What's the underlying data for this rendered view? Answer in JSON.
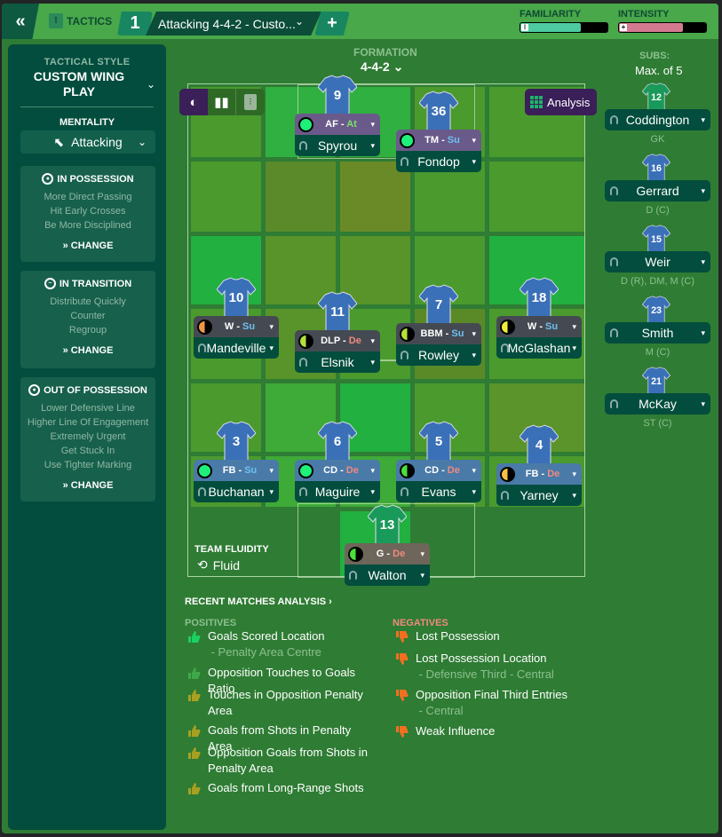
{
  "topbar": {
    "back_icon": "double-chevron-left",
    "tactics_label": "TACTICS",
    "tactic_slot": "1",
    "tactic_name": "Attacking 4-4-2 - Custo...",
    "add_label": "+",
    "familiarity": {
      "label": "FAMILIARITY",
      "value": 0.68,
      "color": "#4ecba0"
    },
    "intensity": {
      "label": "INTENSITY",
      "value": 0.72,
      "color": "#d47a90"
    }
  },
  "left": {
    "tactical_style_label": "TACTICAL STYLE",
    "tactical_style": "CUSTOM WING PLAY",
    "mentality_label": "MENTALITY",
    "mentality": "Attacking",
    "cards": [
      {
        "title": "IN POSSESSION",
        "icon": "football-icon",
        "lines": [
          "More Direct Passing",
          "Hit Early Crosses",
          "Be More Disciplined"
        ],
        "change": "CHANGE"
      },
      {
        "title": "IN TRANSITION",
        "icon": "transition-icon",
        "lines": [
          "Distribute Quickly",
          "Counter",
          "Regroup"
        ],
        "change": "CHANGE"
      },
      {
        "title": "OUT OF POSSESSION",
        "icon": "football-icon",
        "lines": [
          "Lower Defensive Line",
          "Higher Line Of Engagement",
          "Extremely Urgent",
          "Get Stuck In",
          "Use Tighter Marking"
        ],
        "change": "CHANGE"
      }
    ]
  },
  "formation": {
    "label": "FORMATION",
    "value": "4-4-2"
  },
  "analysis_button": "Analysis",
  "players": [
    {
      "number": "9",
      "role": "AF",
      "duty": "At",
      "name": "Spyrou",
      "role_bg": "#6a5a8a",
      "condition": "full",
      "cond_color": "#1ef07a"
    },
    {
      "number": "36",
      "role": "TM",
      "duty": "Su",
      "name": "Fondop",
      "role_bg": "#6a5a8a",
      "condition": "full",
      "cond_color": "#1ef07a"
    },
    {
      "number": "10",
      "role": "W",
      "duty": "Su",
      "name": "Mandeville",
      "role_bg": "#454a52",
      "condition": "half",
      "cond_color": "#f0964a"
    },
    {
      "number": "11",
      "role": "DLP",
      "duty": "De",
      "name": "Elsnik",
      "role_bg": "#454a52",
      "condition": "half",
      "cond_color": "#b4e03a"
    },
    {
      "number": "7",
      "role": "BBM",
      "duty": "Su",
      "name": "Rowley",
      "role_bg": "#454a52",
      "condition": "half",
      "cond_color": "#b4e03a"
    },
    {
      "number": "18",
      "role": "W",
      "duty": "Su",
      "name": "McGlashan",
      "role_bg": "#454a52",
      "condition": "half",
      "cond_color": "#f0ec3a"
    },
    {
      "number": "3",
      "role": "FB",
      "duty": "Su",
      "name": "Buchanan",
      "role_bg": "#4a7aa8",
      "condition": "full",
      "cond_color": "#1ef07a"
    },
    {
      "number": "6",
      "role": "CD",
      "duty": "De",
      "name": "Maguire",
      "role_bg": "#4a7aa8",
      "condition": "full",
      "cond_color": "#1ef07a"
    },
    {
      "number": "5",
      "role": "CD",
      "duty": "De",
      "name": "Evans",
      "role_bg": "#4a7aa8",
      "condition": "half",
      "cond_color": "#4ae03a"
    },
    {
      "number": "4",
      "role": "FB",
      "duty": "De",
      "name": "Yarney",
      "role_bg": "#4a7aa8",
      "condition": "half",
      "cond_color": "#f8c048"
    },
    {
      "number": "13",
      "role": "G",
      "duty": "De",
      "name": "Walton",
      "role_bg": "#6e665a",
      "condition": "half",
      "cond_color": "#4ae03a",
      "gk": true
    }
  ],
  "team_fluidity": {
    "label": "TEAM FLUIDITY",
    "value": "Fluid"
  },
  "subs": {
    "label": "SUBS:",
    "max": "Max. of 5",
    "players": [
      {
        "number": "12",
        "name": "Coddington",
        "position": "GK",
        "gk": true
      },
      {
        "number": "16",
        "name": "Gerrard",
        "position": "D (C)"
      },
      {
        "number": "15",
        "name": "Weir",
        "position": "D (R), DM, M (C)"
      },
      {
        "number": "23",
        "name": "Smith",
        "position": "M (C)"
      },
      {
        "number": "21",
        "name": "McKay",
        "position": "ST (C)"
      }
    ]
  },
  "recent": {
    "title": "RECENT MATCHES ANALYSIS ›",
    "positives_label": "POSITIVES",
    "negatives_label": "NEGATIVES",
    "positives": [
      {
        "text": "Goals Scored Location",
        "detail": "- Penalty Area Centre",
        "color": "#1ad060"
      },
      {
        "text": "Opposition Touches to Goals Ratio",
        "detail": "",
        "color": "#3fa84a"
      },
      {
        "text": "Touches in Opposition Penalty Area",
        "detail": "",
        "color": "#a8a020"
      },
      {
        "text": "Goals from Shots in Penalty Area",
        "detail": "",
        "color": "#a8a020"
      },
      {
        "text": "Opposition Goals from Shots in Penalty Area",
        "detail": "",
        "color": "#a8a020"
      },
      {
        "text": "Goals from Long-Range Shots",
        "detail": "",
        "color": "#a8a020"
      }
    ],
    "negatives": [
      {
        "text": "Lost Possession",
        "detail": "",
        "color": "#f07020"
      },
      {
        "text": "Lost Possession Location",
        "detail": "- Defensive Third - Central",
        "color": "#f07020"
      },
      {
        "text": "Opposition Final Third Entries",
        "detail": "- Central",
        "color": "#f07020"
      },
      {
        "text": "Weak Influence",
        "detail": "",
        "color": "#f07020"
      }
    ]
  }
}
